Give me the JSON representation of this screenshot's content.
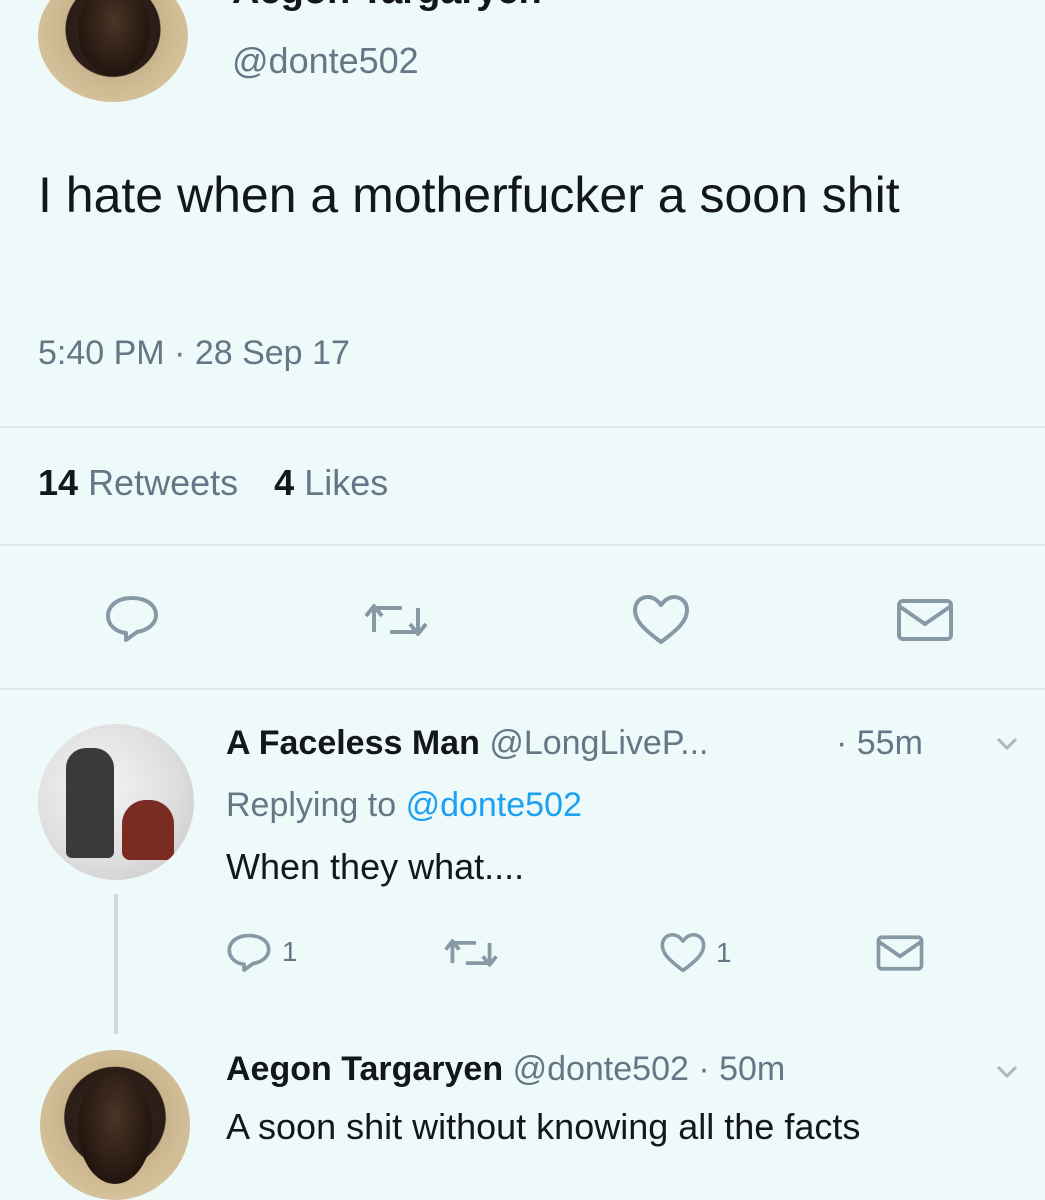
{
  "main_tweet": {
    "author_name": "Aegon Targaryen",
    "handle": "@donte502",
    "text": "I hate when a motherfucker a soon shit",
    "timestamp": "5:40 PM · 28 Sep 17",
    "retweets_count": "14",
    "retweets_label": "Retweets",
    "likes_count": "4",
    "likes_label": "Likes"
  },
  "actions": {
    "icons": [
      "reply-icon",
      "retweet-icon",
      "like-icon",
      "message-icon"
    ]
  },
  "replies": [
    {
      "author_name": "A Faceless Man",
      "handle": "@LongLiveP...",
      "time": "· 55m",
      "replying_prefix": "Replying to",
      "replying_handle": "@donte502",
      "text": "When they what....",
      "reply_count": "1",
      "like_count": "1"
    },
    {
      "author_name": "Aegon Targaryen",
      "handle": "@donte502",
      "time": "· 50m",
      "text": "A soon shit without knowing all the facts"
    }
  ],
  "colors": {
    "background": "#eefafa",
    "text": "#14171a",
    "muted": "#657786",
    "link": "#1da1f2",
    "icon": "#8899a6"
  }
}
